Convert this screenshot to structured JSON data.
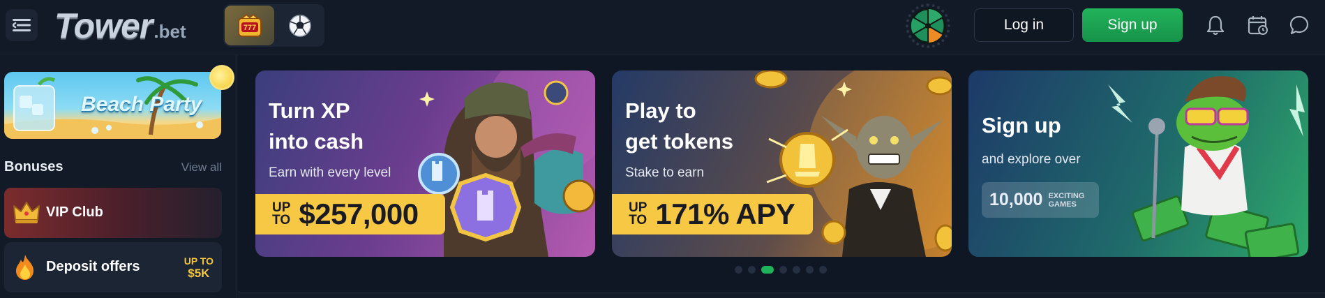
{
  "header": {
    "logo_main": "Tower",
    "logo_tld": ".bet",
    "login_label": "Log in",
    "signup_label": "Sign up"
  },
  "sidebar": {
    "promo_title": "Beach Party",
    "bonuses_title": "Bonuses",
    "view_all": "View all",
    "vip_label": "VIP Club",
    "deposit_label": "Deposit offers",
    "deposit_upto": "UP TO",
    "deposit_value": "$5K"
  },
  "banners": [
    {
      "title_line1": "Turn XP",
      "title_line2": "into cash",
      "subtitle": "Earn with every level",
      "pill_up": "UP",
      "pill_to": "TO",
      "pill_value": "$257,000"
    },
    {
      "title_line1": "Play to",
      "title_line2": "get tokens",
      "subtitle": "Stake to earn",
      "pill_up": "UP",
      "pill_to": "TO",
      "pill_value": "171% APY"
    },
    {
      "title_line1": "Sign up",
      "subtitle": "and explore  over",
      "games_count": "10,000",
      "games_label1": "EXCITING",
      "games_label2": "GAMES"
    }
  ],
  "carousel": {
    "total": 7,
    "active_index": 2
  },
  "colors": {
    "accent_green": "#1fb25a",
    "gold": "#f6c844",
    "bg": "#0f1724"
  },
  "icons": [
    "menu-icon",
    "casino-slot-icon",
    "soccer-ball-icon",
    "fortune-wheel-icon",
    "bell-icon",
    "calendar-icon",
    "chat-icon",
    "crown-icon",
    "fire-icon"
  ]
}
